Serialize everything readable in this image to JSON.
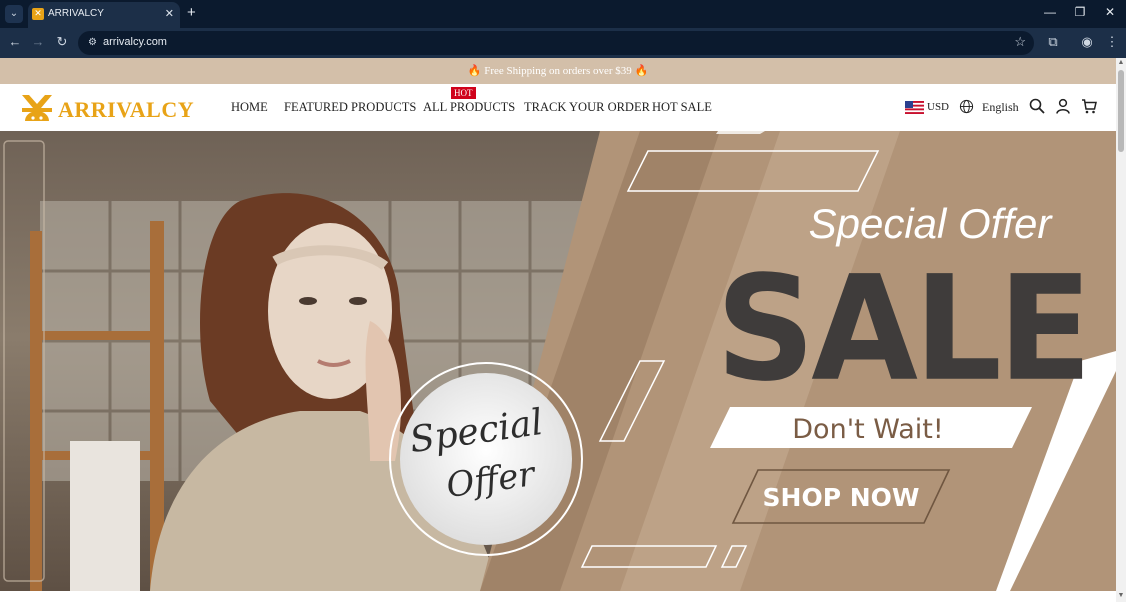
{
  "browser": {
    "tab_title": "ARRIVALCY",
    "url": "arrivalcy.com"
  },
  "announcement": {
    "text": "🔥 Free Shipping on orders over $39 🔥"
  },
  "header": {
    "logo_text": "ARRIVALCY",
    "nav": [
      {
        "label": "HOME"
      },
      {
        "label": "FEATURED PRODUCTS"
      },
      {
        "label": "ALL PRODUCTS",
        "badge": "HOT"
      },
      {
        "label": "TRACK YOUR ORDER"
      },
      {
        "label": "HOT SALE"
      }
    ],
    "currency": "USD",
    "language": "English"
  },
  "hero": {
    "headline": "Special Offer",
    "sale_text": "SALE",
    "subline": "Don't Wait!",
    "cta": "SHOP NOW",
    "circle_line1": "Special",
    "circle_line2": "Offer"
  },
  "colors": {
    "brand": "#e8a317",
    "announcement_bg": "#d3bfa9",
    "hero_tan": "#a98d70",
    "hot_badge": "#d0021b"
  }
}
